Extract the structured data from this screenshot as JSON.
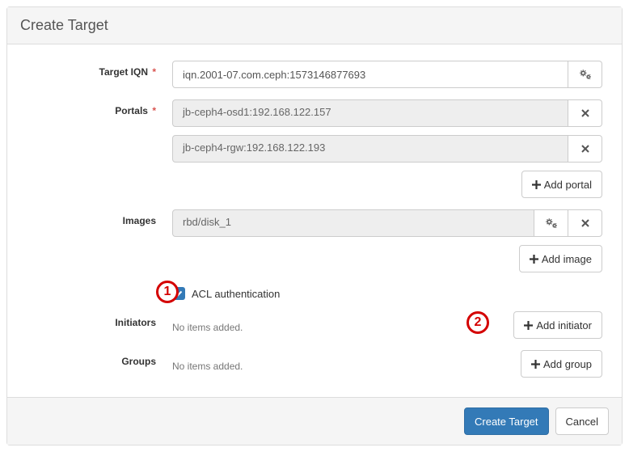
{
  "header": {
    "title": "Create Target"
  },
  "target_iqn": {
    "label": "Target IQN",
    "required_mark": "*",
    "value": "iqn.2001-07.com.ceph:1573146877693"
  },
  "portals": {
    "label": "Portals",
    "required_mark": "*",
    "items": [
      "jb-ceph4-osd1:192.168.122.157",
      "jb-ceph4-rgw:192.168.122.193"
    ],
    "add_label": "Add portal"
  },
  "images": {
    "label": "Images",
    "items": [
      "rbd/disk_1"
    ],
    "add_label": "Add image"
  },
  "acl": {
    "checked": true,
    "label": "ACL authentication"
  },
  "initiators": {
    "label": "Initiators",
    "empty_text": "No items added.",
    "add_label": "Add initiator"
  },
  "groups": {
    "label": "Groups",
    "empty_text": "No items added.",
    "add_label": "Add group"
  },
  "footer": {
    "submit_label": "Create Target",
    "cancel_label": "Cancel"
  },
  "annotations": {
    "one": "1",
    "two": "2"
  }
}
